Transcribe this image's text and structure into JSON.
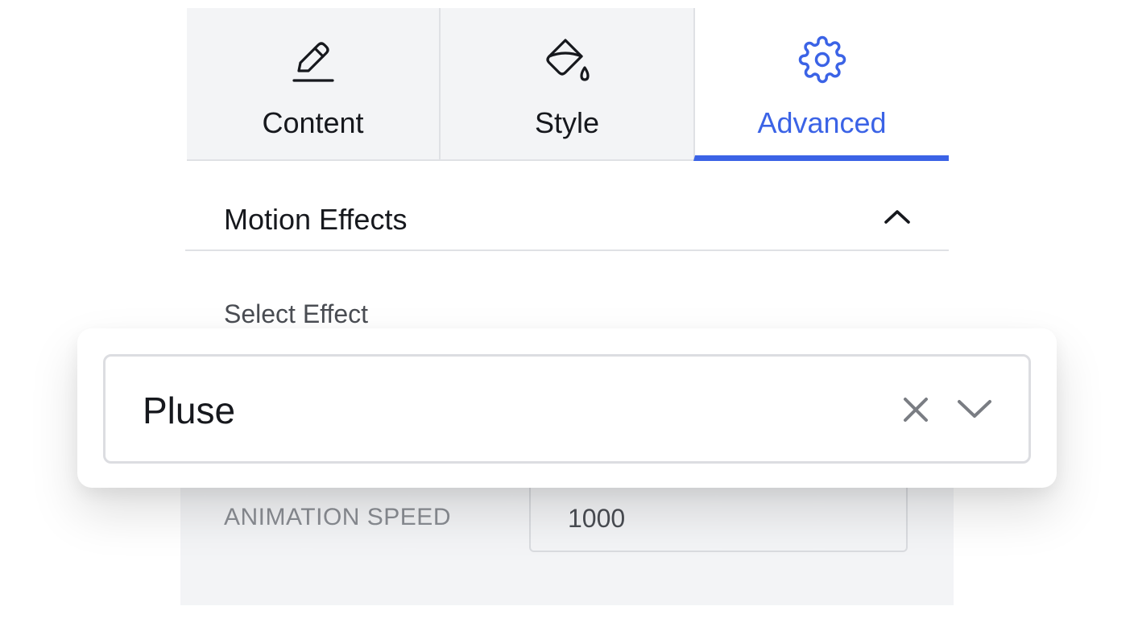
{
  "tabs": [
    {
      "label": "Content",
      "icon": "pencil-icon",
      "active": false
    },
    {
      "label": "Style",
      "icon": "paint-bucket-icon",
      "active": false
    },
    {
      "label": "Advanced",
      "icon": "gear-icon",
      "active": true
    }
  ],
  "section": {
    "title": "Motion Effects",
    "expanded": true
  },
  "select_effect": {
    "label": "Select Effect",
    "value": "Pluse"
  },
  "animation_speed": {
    "label": "ANIMATION SPEED",
    "value": "1000"
  },
  "colors": {
    "accent": "#3b63e6",
    "text": "#16181d",
    "muted": "#8a8d93",
    "tab_bg": "#f3f4f6"
  }
}
